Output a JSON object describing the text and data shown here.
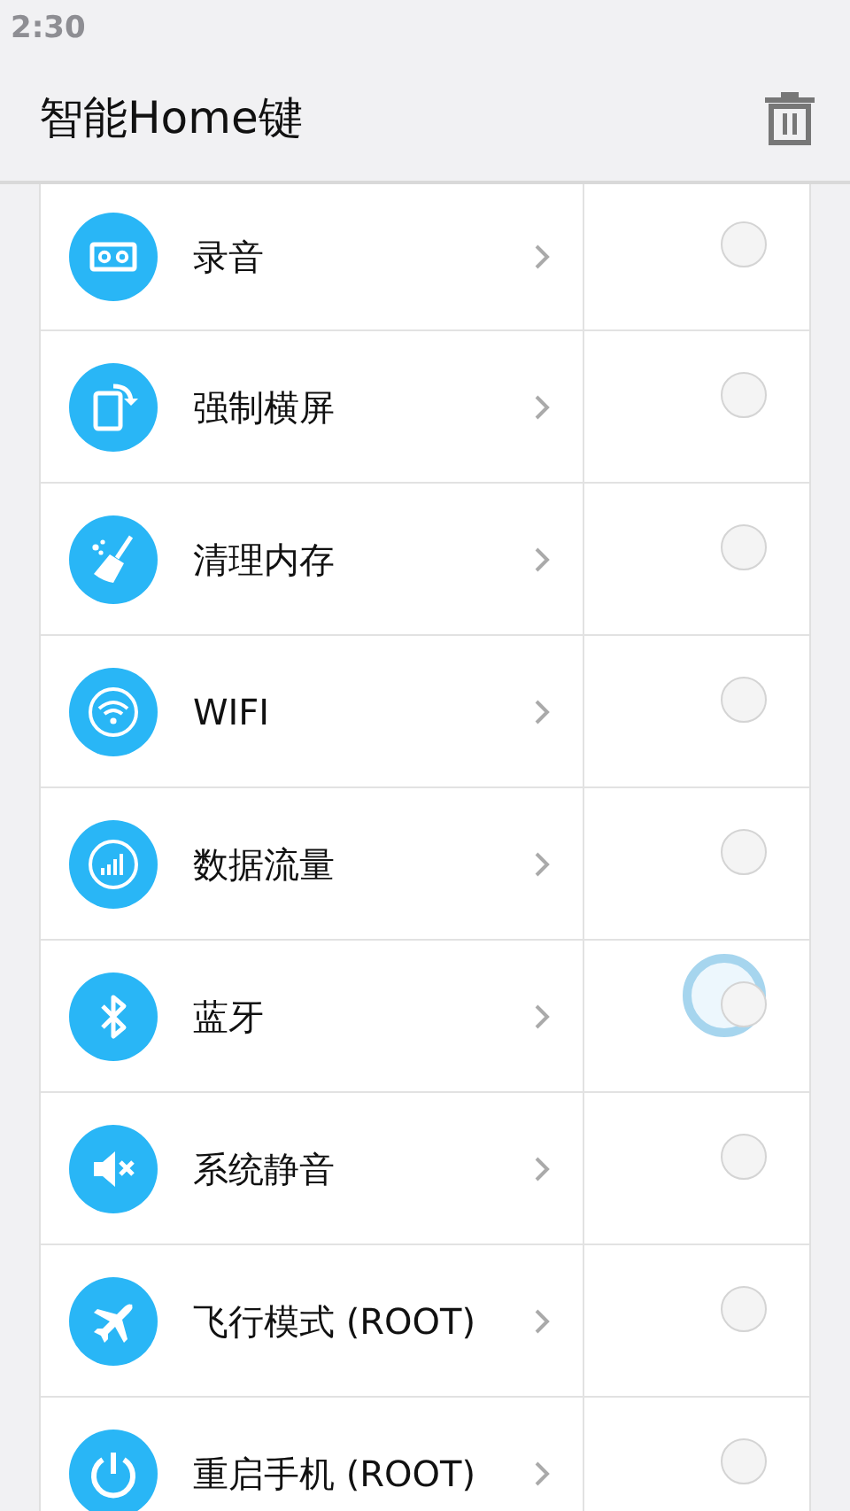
{
  "status_bar": {
    "time": "2:30"
  },
  "app_bar": {
    "title": "智能Home键"
  },
  "items": [
    {
      "kind": "record",
      "label": "录音",
      "selected": false
    },
    {
      "kind": "rotate",
      "label": "强制横屏",
      "selected": false
    },
    {
      "kind": "clean",
      "label": "清理内存",
      "selected": false
    },
    {
      "kind": "wifi",
      "label": "WIFI",
      "selected": false
    },
    {
      "kind": "data",
      "label": "数据流量",
      "selected": false
    },
    {
      "kind": "bluetooth",
      "label": "蓝牙",
      "selected": false
    },
    {
      "kind": "mute",
      "label": "系统静音",
      "selected": false
    },
    {
      "kind": "airplane",
      "label": "飞行模式 (ROOT)",
      "selected": false
    },
    {
      "kind": "restart",
      "label": "重启手机 (ROOT)",
      "selected": false
    }
  ]
}
